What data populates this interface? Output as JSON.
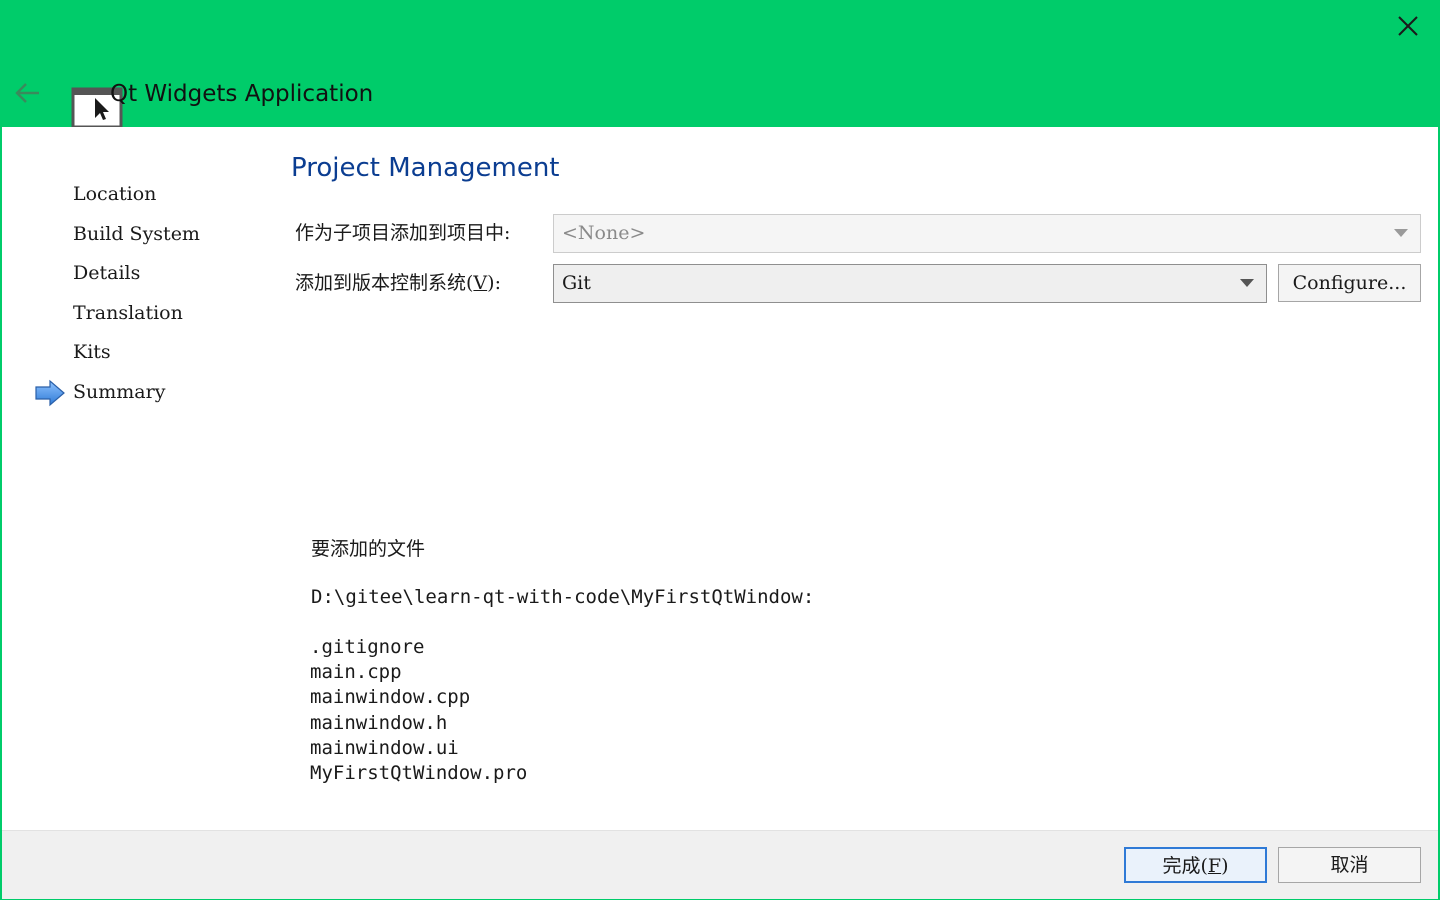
{
  "window": {
    "title": "Qt Widgets Application",
    "colors": {
      "header_background": "#00cc6a",
      "title_accent": "#0b3d91",
      "default_button_border": "#2f7ad6"
    }
  },
  "header": {
    "back_icon": "arrow-left-icon",
    "close_icon": "close-icon",
    "app_icon": "window-cursor-icon"
  },
  "sidebar": {
    "items": [
      {
        "label": "Location"
      },
      {
        "label": "Build System"
      },
      {
        "label": "Details"
      },
      {
        "label": "Translation"
      },
      {
        "label": "Kits"
      },
      {
        "label": "Summary",
        "current": true
      }
    ],
    "current_indicator_icon": "arrow-right-icon"
  },
  "page": {
    "title": "Project Management",
    "parent_project": {
      "label": "作为子项目添加到项目中:",
      "value": "<None>",
      "enabled": false
    },
    "vcs": {
      "label_prefix": "添加到版本控制系统(",
      "label_mnemonic": "V",
      "label_suffix": "):",
      "value": "Git",
      "configure_label": "Configure..."
    },
    "summary": {
      "heading": "要添加的文件",
      "path": "D:\\gitee\\learn-qt-with-code\\MyFirstQtWindow:",
      "files": [
        ".gitignore",
        "main.cpp",
        "mainwindow.cpp",
        "mainwindow.h",
        "mainwindow.ui",
        "MyFirstQtWindow.pro"
      ]
    }
  },
  "footer": {
    "finish_prefix": "完成(",
    "finish_mnemonic": "F",
    "finish_suffix": ")",
    "cancel_label": "取消"
  }
}
